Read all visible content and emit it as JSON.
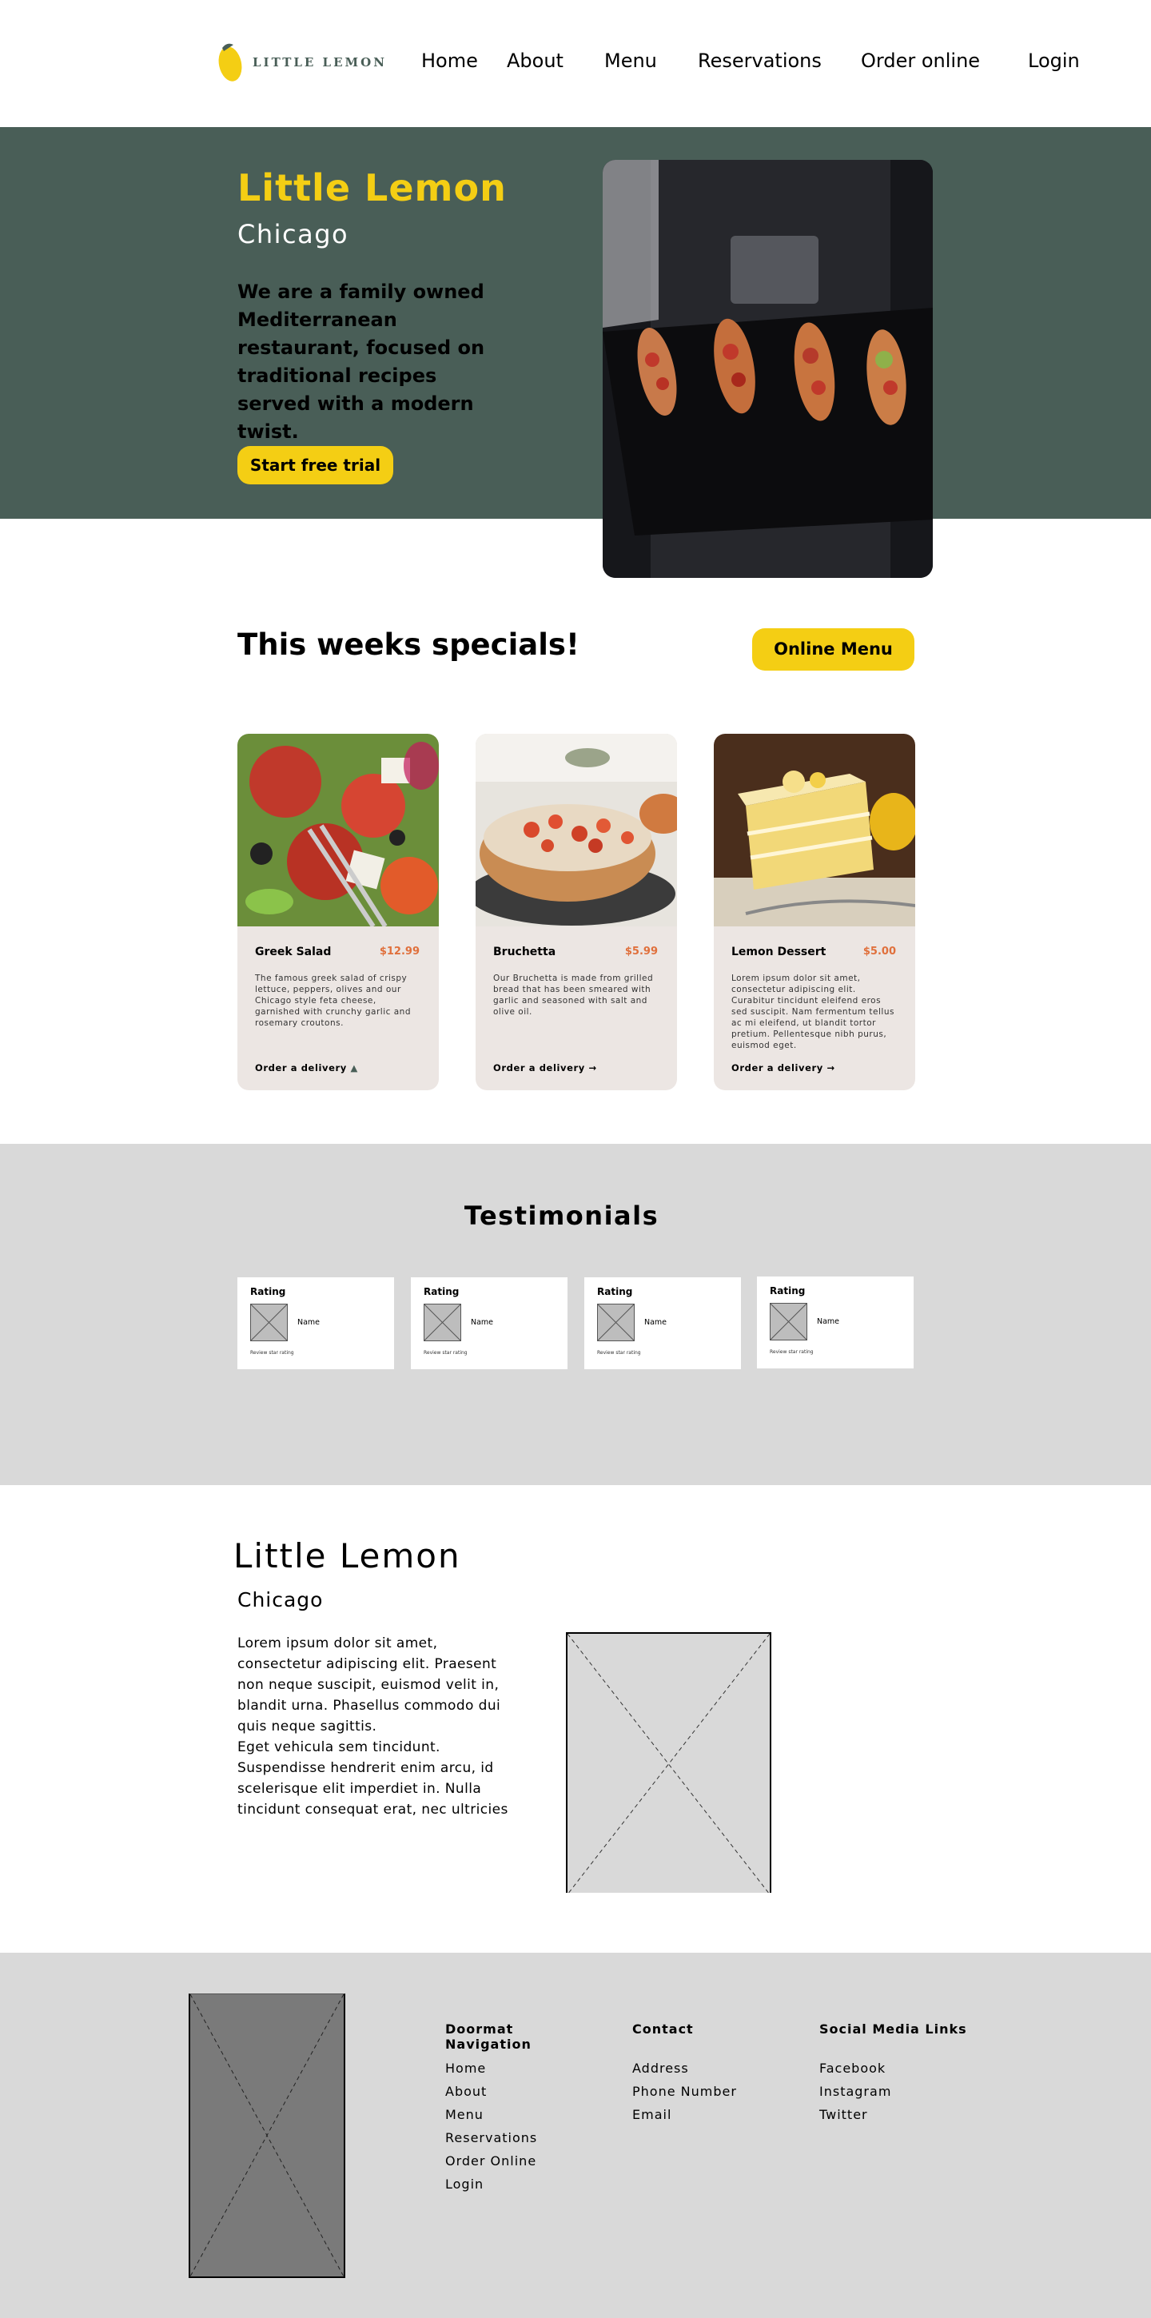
{
  "header": {
    "logo_text": "LITTLE LEMON",
    "nav": [
      "Home",
      "About",
      "Menu",
      "Reservations",
      "Order online",
      "Login"
    ]
  },
  "hero": {
    "title": "Little Lemon",
    "subtitle": "Chicago",
    "description": "We are a family owned Mediterranean restaurant, focused on traditional recipes served with a modern twist.",
    "cta": "Start free trial"
  },
  "specials": {
    "title": "This weeks specials!",
    "menu_button": "Online Menu",
    "cards": [
      {
        "name": "Greek Salad",
        "price": "$12.99",
        "description": "The famous greek salad of crispy lettuce, peppers, olives and our Chicago style feta cheese, garnished with crunchy garlic and rosemary croutons.",
        "link": "Order a delivery",
        "link_icon": "scooter-icon"
      },
      {
        "name": "Bruchetta",
        "price": "$5.99",
        "description": "Our Bruchetta is made from grilled bread that has been smeared with garlic and seasoned with salt and olive oil.",
        "link": "Order a delivery",
        "link_icon": "arrow-right-icon"
      },
      {
        "name": "Lemon Dessert",
        "price": "$5.00",
        "description": "Lorem ipsum dolor sit amet, consectetur adipiscing elit. Curabitur tincidunt eleifend eros sed suscipit. Nam fermentum tellus ac mi eleifend, ut blandit tortor pretium. Pellentesque nibh purus, euismod eget.",
        "link": "Order a delivery",
        "link_icon": "arrow-right-icon"
      }
    ]
  },
  "testimonials": {
    "title": "Testimonials",
    "cards": [
      {
        "rating": "Rating",
        "name": "Name",
        "review": "Review star rating"
      },
      {
        "rating": "Rating",
        "name": "Name",
        "review": "Review star rating"
      },
      {
        "rating": "Rating",
        "name": "Name",
        "review": "Review star rating"
      },
      {
        "rating": "Rating",
        "name": "Name",
        "review": "Review star rating"
      }
    ]
  },
  "about": {
    "title": "Little Lemon",
    "subtitle": "Chicago",
    "text": "Lorem ipsum dolor sit amet, consectetur adipiscing elit. Praesent non neque suscipit, euismod velit in, blandit urna. Phasellus commodo dui quis neque sagittis.\nEget vehicula sem tincidunt. Suspendisse hendrerit enim arcu, id scelerisque elit imperdiet in. Nulla tincidunt consequat erat, nec ultricies"
  },
  "footer": {
    "doormat": {
      "heading": "Doormat Navigation",
      "items": [
        "Home",
        "About",
        "Menu",
        "Reservations",
        "Order Online",
        "Login"
      ]
    },
    "contact": {
      "heading": "Contact",
      "items": [
        "Address",
        "Phone Number",
        "Email"
      ]
    },
    "social": {
      "heading": "Social Media Links",
      "items": [
        "Facebook",
        "Instagram",
        "Twitter"
      ]
    }
  },
  "colors": {
    "primary_green": "#495E57",
    "primary_yellow": "#F4CE14",
    "accent_orange": "#E0703C",
    "card_bg": "#ECE6E3",
    "section_gray": "#D9D9D9"
  }
}
